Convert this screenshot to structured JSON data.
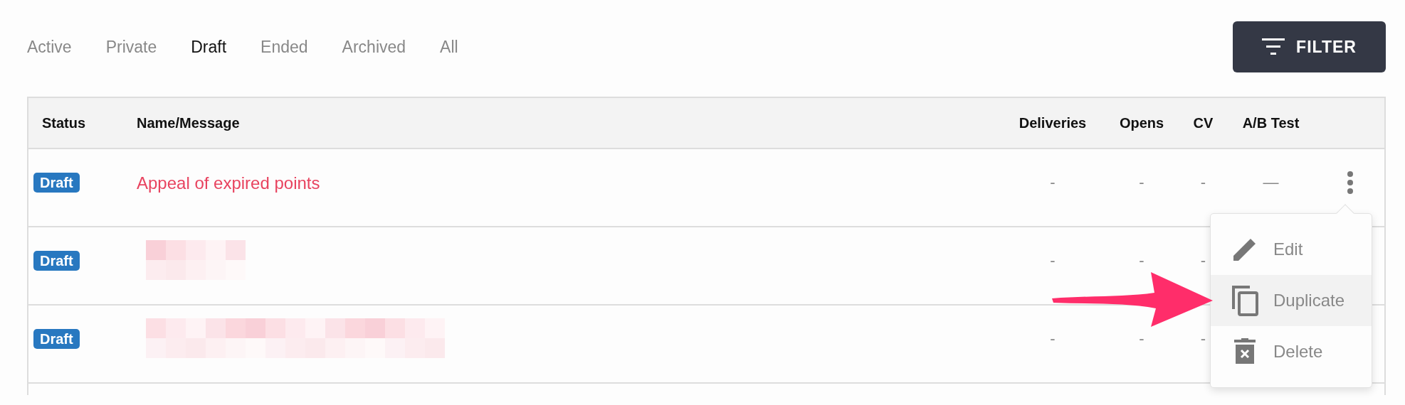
{
  "tabs": [
    {
      "label": "Active",
      "selected": false
    },
    {
      "label": "Private",
      "selected": false
    },
    {
      "label": "Draft",
      "selected": true
    },
    {
      "label": "Ended",
      "selected": false
    },
    {
      "label": "Archived",
      "selected": false
    },
    {
      "label": "All",
      "selected": false
    }
  ],
  "filter_button": {
    "label": "FILTER"
  },
  "table": {
    "columns": [
      "Status",
      "Name/Message",
      "Deliveries",
      "Opens",
      "CV",
      "A/B Test"
    ],
    "rows": [
      {
        "status": "Draft",
        "name": "Appeal of expired points",
        "deliveries": "-",
        "opens": "-",
        "cv": "-",
        "ab_test": "—",
        "menu_open": true
      },
      {
        "status": "Draft",
        "name_redacted": true,
        "deliveries": "-",
        "opens": "-",
        "cv": "-"
      },
      {
        "status": "Draft",
        "name_redacted": true,
        "deliveries": "-",
        "opens": "-",
        "cv": "-"
      }
    ]
  },
  "row_menu": {
    "items": [
      {
        "label": "Edit",
        "selected": false
      },
      {
        "label": "Duplicate",
        "selected": true
      },
      {
        "label": "Delete",
        "selected": false
      }
    ]
  }
}
